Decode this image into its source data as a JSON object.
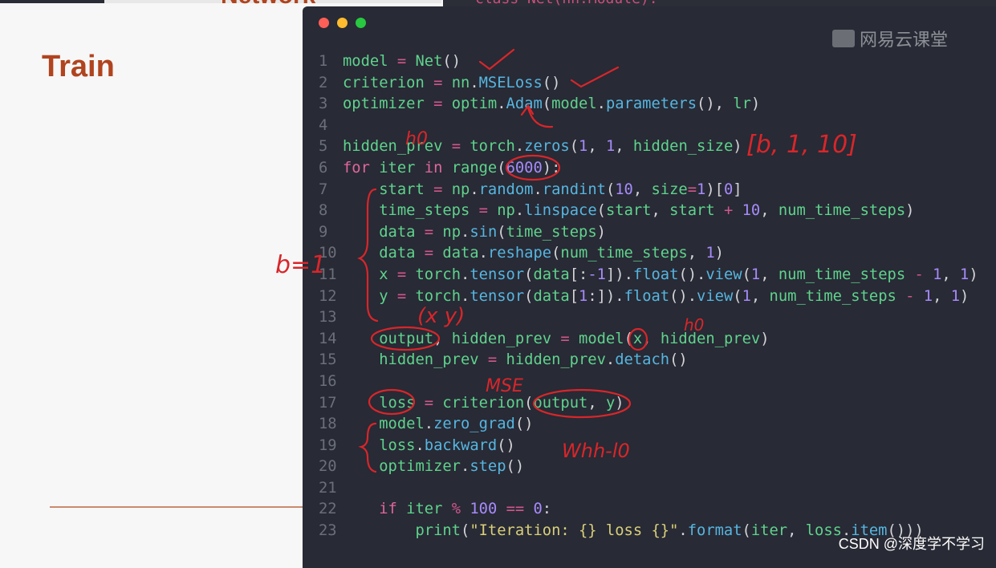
{
  "slide": {
    "title_cut": "Network",
    "title": "Train",
    "background_code": "class Net(nn.Module):"
  },
  "window": {
    "controls": [
      "close",
      "minimize",
      "maximize"
    ],
    "colors": {
      "close": "#fe5f57",
      "minimize": "#febc2e",
      "maximize": "#28c840"
    },
    "logo": "网易云课堂"
  },
  "code": {
    "lines": [
      {
        "n": "1",
        "t": [
          [
            "model",
            "v"
          ],
          [
            " = ",
            "o"
          ],
          [
            "Net",
            "v"
          ],
          [
            "()",
            "p"
          ]
        ]
      },
      {
        "n": "2",
        "t": [
          [
            "criterion",
            "v"
          ],
          [
            " = ",
            "o"
          ],
          [
            "nn",
            "v"
          ],
          [
            ".",
            "p"
          ],
          [
            "MSELoss",
            "f"
          ],
          [
            "()",
            "p"
          ]
        ]
      },
      {
        "n": "3",
        "t": [
          [
            "optimizer",
            "v"
          ],
          [
            " = ",
            "o"
          ],
          [
            "optim",
            "v"
          ],
          [
            ".",
            "p"
          ],
          [
            "Adam",
            "f"
          ],
          [
            "(",
            "p"
          ],
          [
            "model",
            "v"
          ],
          [
            ".",
            "p"
          ],
          [
            "parameters",
            "f"
          ],
          [
            "(), ",
            "p"
          ],
          [
            "lr",
            "v"
          ],
          [
            ")",
            "p"
          ]
        ]
      },
      {
        "n": "4",
        "t": []
      },
      {
        "n": "5",
        "t": [
          [
            "hidden_prev",
            "v"
          ],
          [
            " = ",
            "o"
          ],
          [
            "torch",
            "v"
          ],
          [
            ".",
            "p"
          ],
          [
            "zeros",
            "f"
          ],
          [
            "(",
            "p"
          ],
          [
            "1",
            "n"
          ],
          [
            ", ",
            "p"
          ],
          [
            "1",
            "n"
          ],
          [
            ", ",
            "p"
          ],
          [
            "hidden_size",
            "v"
          ],
          [
            ")",
            "p"
          ]
        ]
      },
      {
        "n": "6",
        "t": [
          [
            "for ",
            "k"
          ],
          [
            "iter ",
            "v"
          ],
          [
            "in ",
            "k"
          ],
          [
            "range",
            "v"
          ],
          [
            "(",
            "p"
          ],
          [
            "6000",
            "n"
          ],
          [
            "):",
            "p"
          ]
        ]
      },
      {
        "n": "7",
        "t": [
          [
            "    start",
            "v"
          ],
          [
            " = ",
            "o"
          ],
          [
            "np",
            "v"
          ],
          [
            ".",
            "p"
          ],
          [
            "random",
            "f"
          ],
          [
            ".",
            "p"
          ],
          [
            "randint",
            "f"
          ],
          [
            "(",
            "p"
          ],
          [
            "10",
            "n"
          ],
          [
            ", ",
            "p"
          ],
          [
            "size",
            "v"
          ],
          [
            "=",
            "o"
          ],
          [
            "1",
            "n"
          ],
          [
            ")[",
            "p"
          ],
          [
            "0",
            "n"
          ],
          [
            "]",
            "p"
          ]
        ]
      },
      {
        "n": "8",
        "t": [
          [
            "    time_steps",
            "v"
          ],
          [
            " = ",
            "o"
          ],
          [
            "np",
            "v"
          ],
          [
            ".",
            "p"
          ],
          [
            "linspace",
            "f"
          ],
          [
            "(",
            "p"
          ],
          [
            "start",
            "v"
          ],
          [
            ", ",
            "p"
          ],
          [
            "start",
            "v"
          ],
          [
            " + ",
            "o"
          ],
          [
            "10",
            "n"
          ],
          [
            ", ",
            "p"
          ],
          [
            "num_time_steps",
            "v"
          ],
          [
            ")",
            "p"
          ]
        ]
      },
      {
        "n": "9",
        "t": [
          [
            "    data",
            "v"
          ],
          [
            " = ",
            "o"
          ],
          [
            "np",
            "v"
          ],
          [
            ".",
            "p"
          ],
          [
            "sin",
            "f"
          ],
          [
            "(",
            "p"
          ],
          [
            "time_steps",
            "v"
          ],
          [
            ")",
            "p"
          ]
        ]
      },
      {
        "n": "10",
        "t": [
          [
            "    data",
            "v"
          ],
          [
            " = ",
            "o"
          ],
          [
            "data",
            "v"
          ],
          [
            ".",
            "p"
          ],
          [
            "reshape",
            "f"
          ],
          [
            "(",
            "p"
          ],
          [
            "num_time_steps",
            "v"
          ],
          [
            ", ",
            "p"
          ],
          [
            "1",
            "n"
          ],
          [
            ")",
            "p"
          ]
        ]
      },
      {
        "n": "11",
        "t": [
          [
            "    x",
            "v"
          ],
          [
            " = ",
            "o"
          ],
          [
            "torch",
            "v"
          ],
          [
            ".",
            "p"
          ],
          [
            "tensor",
            "f"
          ],
          [
            "(",
            "p"
          ],
          [
            "data",
            "v"
          ],
          [
            "[:",
            "p"
          ],
          [
            "-1",
            "n"
          ],
          [
            "]).",
            "p"
          ],
          [
            "float",
            "f"
          ],
          [
            "().",
            "p"
          ],
          [
            "view",
            "f"
          ],
          [
            "(",
            "p"
          ],
          [
            "1",
            "n"
          ],
          [
            ", ",
            "p"
          ],
          [
            "num_time_steps",
            "v"
          ],
          [
            " - ",
            "o"
          ],
          [
            "1",
            "n"
          ],
          [
            ", ",
            "p"
          ],
          [
            "1",
            "n"
          ],
          [
            ")",
            "p"
          ]
        ]
      },
      {
        "n": "12",
        "t": [
          [
            "    y",
            "v"
          ],
          [
            " = ",
            "o"
          ],
          [
            "torch",
            "v"
          ],
          [
            ".",
            "p"
          ],
          [
            "tensor",
            "f"
          ],
          [
            "(",
            "p"
          ],
          [
            "data",
            "v"
          ],
          [
            "[",
            "p"
          ],
          [
            "1",
            "n"
          ],
          [
            ":]).",
            "p"
          ],
          [
            "float",
            "f"
          ],
          [
            "().",
            "p"
          ],
          [
            "view",
            "f"
          ],
          [
            "(",
            "p"
          ],
          [
            "1",
            "n"
          ],
          [
            ", ",
            "p"
          ],
          [
            "num_time_steps",
            "v"
          ],
          [
            " - ",
            "o"
          ],
          [
            "1",
            "n"
          ],
          [
            ", ",
            "p"
          ],
          [
            "1",
            "n"
          ],
          [
            ")",
            "p"
          ]
        ]
      },
      {
        "n": "13",
        "t": []
      },
      {
        "n": "14",
        "t": [
          [
            "    output",
            "v"
          ],
          [
            ", ",
            "p"
          ],
          [
            "hidden_prev",
            "v"
          ],
          [
            " = ",
            "o"
          ],
          [
            "model",
            "v"
          ],
          [
            "(",
            "p"
          ],
          [
            "x",
            "v"
          ],
          [
            ", ",
            "p"
          ],
          [
            "hidden_prev",
            "v"
          ],
          [
            ")",
            "p"
          ]
        ]
      },
      {
        "n": "15",
        "t": [
          [
            "    hidden_prev",
            "v"
          ],
          [
            " = ",
            "o"
          ],
          [
            "hidden_prev",
            "v"
          ],
          [
            ".",
            "p"
          ],
          [
            "detach",
            "f"
          ],
          [
            "()",
            "p"
          ]
        ]
      },
      {
        "n": "16",
        "t": []
      },
      {
        "n": "17",
        "t": [
          [
            "    loss",
            "v"
          ],
          [
            " = ",
            "o"
          ],
          [
            "criterion",
            "v"
          ],
          [
            "(",
            "p"
          ],
          [
            "output",
            "v"
          ],
          [
            ", ",
            "p"
          ],
          [
            "y",
            "v"
          ],
          [
            ")",
            "p"
          ]
        ]
      },
      {
        "n": "18",
        "t": [
          [
            "    model",
            "v"
          ],
          [
            ".",
            "p"
          ],
          [
            "zero_grad",
            "f"
          ],
          [
            "()",
            "p"
          ]
        ]
      },
      {
        "n": "19",
        "t": [
          [
            "    loss",
            "v"
          ],
          [
            ".",
            "p"
          ],
          [
            "backward",
            "f"
          ],
          [
            "()",
            "p"
          ]
        ]
      },
      {
        "n": "20",
        "t": [
          [
            "    optimizer",
            "v"
          ],
          [
            ".",
            "p"
          ],
          [
            "step",
            "f"
          ],
          [
            "()",
            "p"
          ]
        ]
      },
      {
        "n": "21",
        "t": []
      },
      {
        "n": "22",
        "t": [
          [
            "    if ",
            "k"
          ],
          [
            "iter ",
            "v"
          ],
          [
            "% ",
            "o"
          ],
          [
            "100 ",
            "n"
          ],
          [
            "== ",
            "o"
          ],
          [
            "0",
            "n"
          ],
          [
            ":",
            "p"
          ]
        ]
      },
      {
        "n": "23",
        "t": [
          [
            "        print",
            "v"
          ],
          [
            "(",
            "p"
          ],
          [
            "\"Iteration: {} loss {}\"",
            "s"
          ],
          [
            ".",
            "p"
          ],
          [
            "format",
            "f"
          ],
          [
            "(",
            "p"
          ],
          [
            "iter",
            "v"
          ],
          [
            ", ",
            "p"
          ],
          [
            "loss",
            "v"
          ],
          [
            ".",
            "p"
          ],
          [
            "item",
            "f"
          ],
          [
            "()))",
            "p"
          ]
        ]
      }
    ]
  },
  "annotations": {
    "h0_top": "h0",
    "shape": "[b, 1, 10]",
    "batch": "b=1",
    "xy": "(x  y)",
    "h0_mid": "h0",
    "mse": "MSE",
    "whh": "Whh-l0",
    "ink_color": "#d8262a"
  },
  "watermark": "CSDN @深度学不学习"
}
